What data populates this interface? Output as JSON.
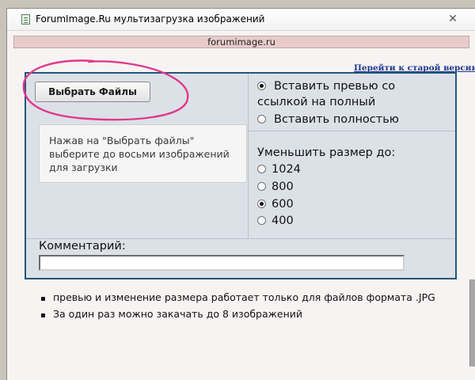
{
  "window": {
    "title": "ForumImage.Ru мультизагрузка изображений",
    "icon": "page-icon",
    "close_glyph": "✕"
  },
  "address": {
    "domain": "forumimage.ru"
  },
  "old_version_link": "Перейти к старой версии",
  "upload": {
    "select_files_label": "Выбрать Файлы",
    "hint": "Нажав на \"Выбрать файлы\" выберите до восьми изображений для загрузки"
  },
  "insert_mode": {
    "options": [
      {
        "label": "Вставить превью со ссылкой на полный",
        "checked": true
      },
      {
        "label": "Вставить полностью",
        "checked": false
      }
    ]
  },
  "resize": {
    "label": "Уменьшить размер до:",
    "options": [
      {
        "label": "1024",
        "checked": false
      },
      {
        "label": "800",
        "checked": false
      },
      {
        "label": "600",
        "checked": true
      },
      {
        "label": "400",
        "checked": false
      }
    ]
  },
  "comment": {
    "label": "Комментарий:",
    "value": ""
  },
  "notes": [
    "превью и изменение размера работает только для файлов формата .JPG",
    "За один раз можно закачать до 8 изображений"
  ],
  "colors": {
    "panel_border": "#23567c",
    "panel_bg": "#dce1e7",
    "annotation": "#e0388c",
    "link": "#1a3a8c"
  }
}
